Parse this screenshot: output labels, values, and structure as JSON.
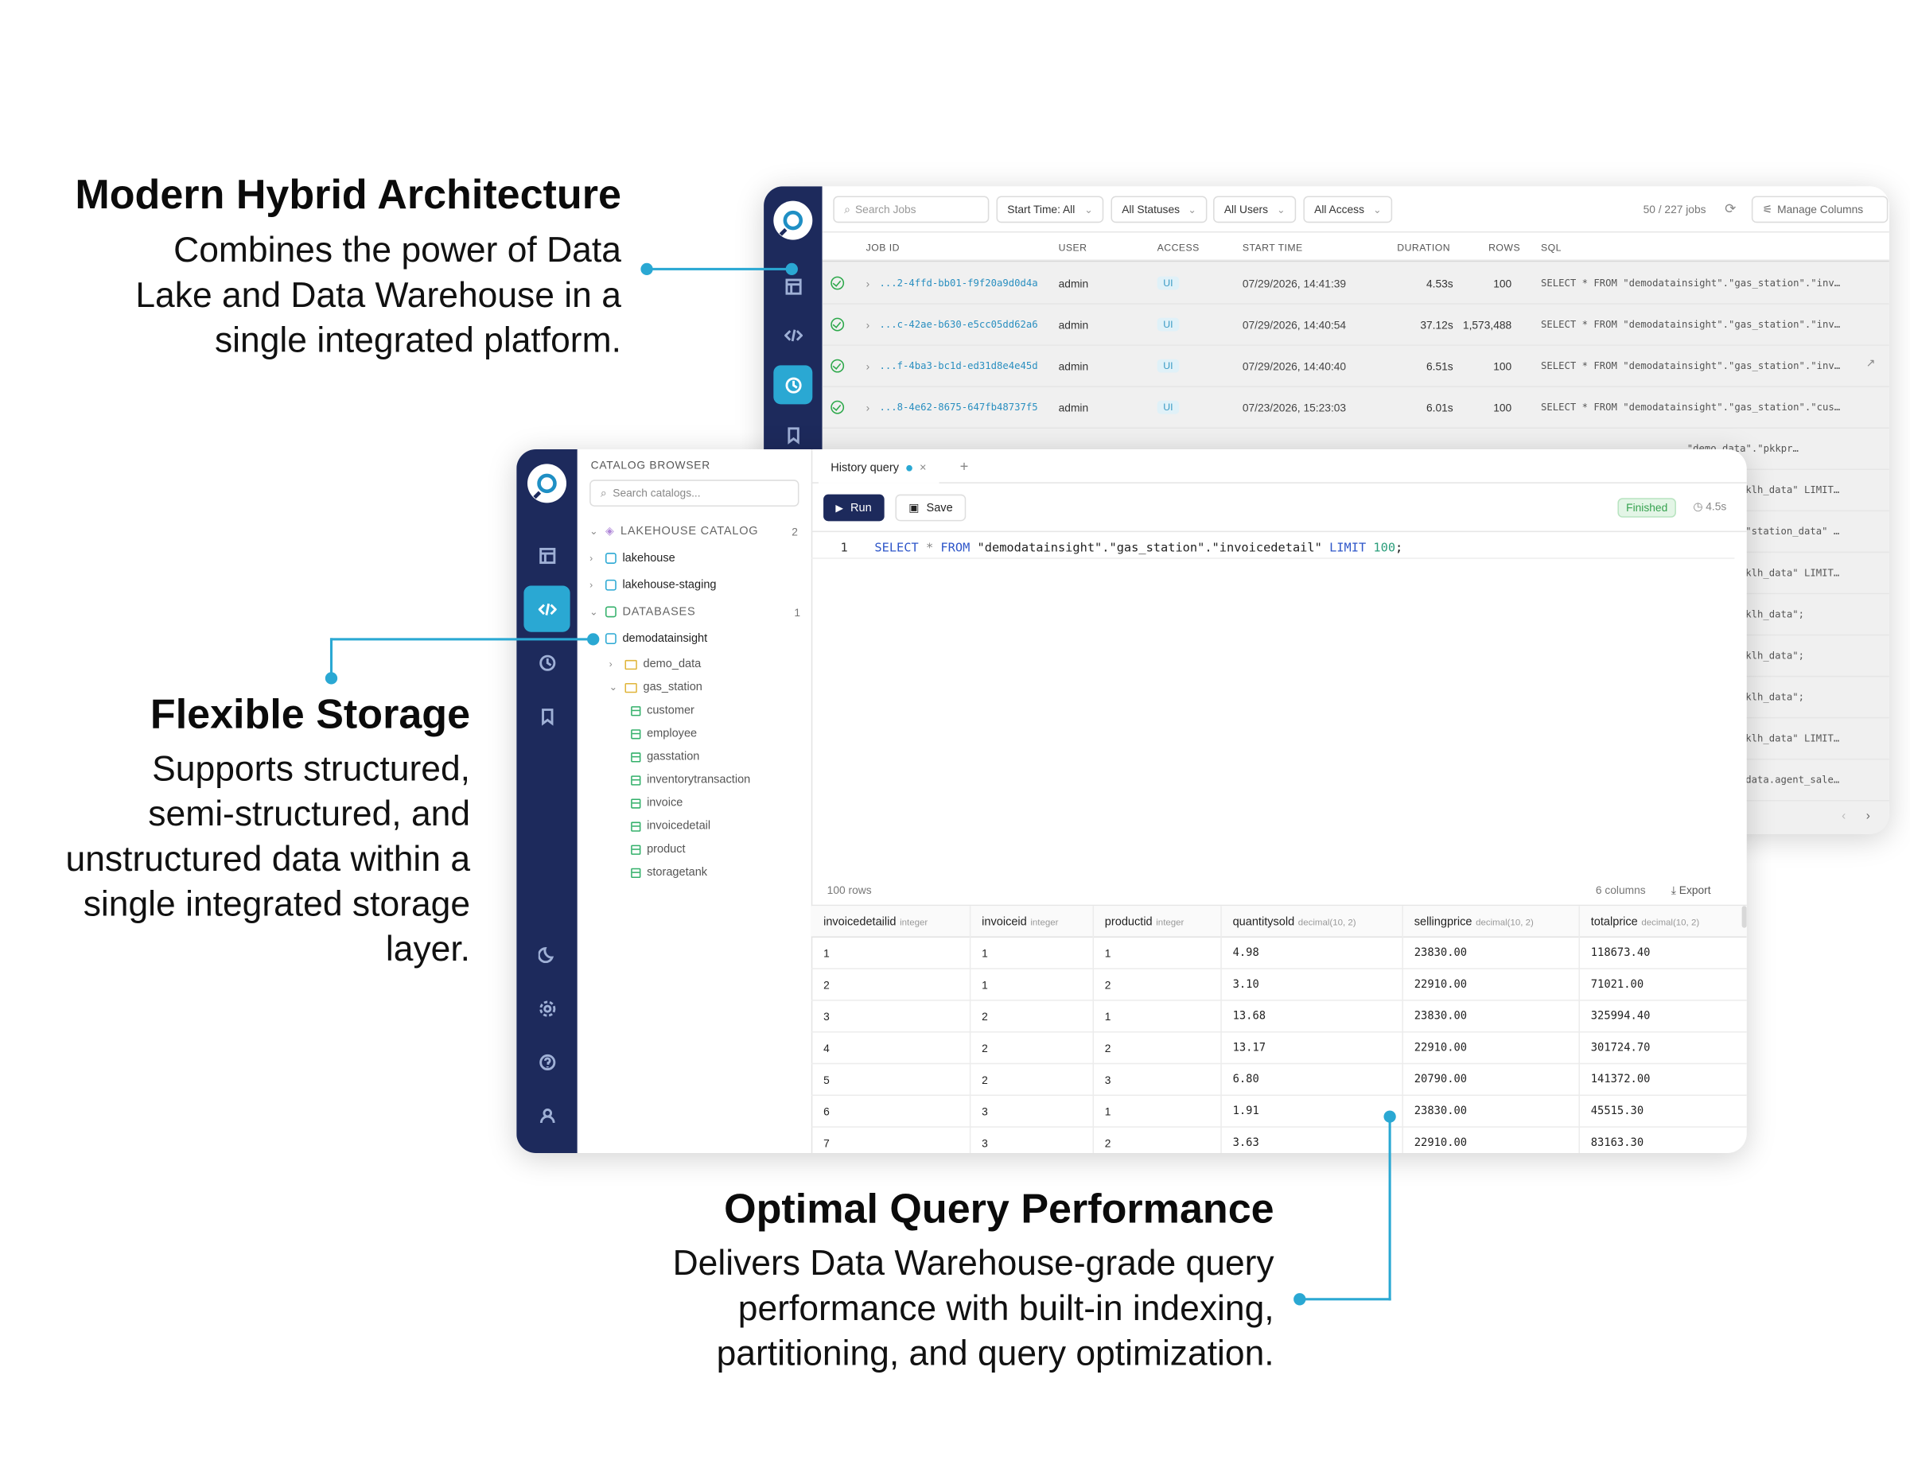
{
  "callouts": {
    "architecture": {
      "title": "Modern Hybrid Architecture",
      "lines": [
        "Combines the power of Data",
        "Lake and Data Warehouse in a",
        "single integrated platform."
      ]
    },
    "storage": {
      "title": "Flexible Storage",
      "lines": [
        "Supports structured,",
        "semi-structured, and",
        "unstructured data within a",
        "single integrated storage",
        "layer."
      ]
    },
    "performance": {
      "title": "Optimal Query Performance",
      "lines": [
        "Delivers Data Warehouse-grade query",
        "performance with built-in indexing,",
        "partitioning, and query optimization."
      ]
    }
  },
  "jobs": {
    "search_placeholder": "Search Jobs",
    "filters": [
      "Start Time: All",
      "All Statuses",
      "All Users",
      "All Access"
    ],
    "count": "50 / 227 jobs",
    "manage_columns": "Manage Columns",
    "columns": [
      "JOB ID",
      "USER",
      "ACCESS",
      "START TIME",
      "DURATION",
      "ROWS",
      "SQL"
    ],
    "rows": [
      {
        "id": "...2-4ffd-bb01-f9f20a9d0d4a",
        "user": "admin",
        "access": "UI",
        "start": "07/29/2026, 14:41:39",
        "duration": "4.53s",
        "rows": "100",
        "sql": "SELECT * FROM \"demodatainsight\".\"gas_station\".\"inv…"
      },
      {
        "id": "...c-42ae-b630-e5cc05dd62a6",
        "user": "admin",
        "access": "UI",
        "start": "07/29/2026, 14:40:54",
        "duration": "37.12s",
        "rows": "1,573,488",
        "sql": "SELECT * FROM \"demodatainsight\".\"gas_station\".\"inv…"
      },
      {
        "id": "...f-4ba3-bc1d-ed31d8e4e45d",
        "user": "admin",
        "access": "UI",
        "start": "07/29/2026, 14:40:40",
        "duration": "6.51s",
        "rows": "100",
        "sql": "SELECT * FROM \"demodatainsight\".\"gas_station\".\"inv…"
      },
      {
        "id": "...8-4e62-8675-647fb48737f5",
        "user": "admin",
        "access": "UI",
        "start": "07/23/2026, 15:23:03",
        "duration": "6.01s",
        "rows": "100",
        "sql": "SELECT * FROM \"demodatainsight\".\"gas_station\".\"cus…"
      }
    ],
    "partial_sql": [
      "\"demo_data\".\"pkkpr…",
      "klh_data\" LIMIT…",
      "\"station_data\" …",
      "klh_data\" LIMIT…",
      "klh_data\";",
      "klh_data\";",
      "klh_data\";",
      "klh_data\" LIMIT…",
      "data.agent_sale…"
    ]
  },
  "catalog": {
    "title": "CATALOG BROWSER",
    "search_placeholder": "Search catalogs...",
    "lakehouse_section": "LAKEHOUSE CATALOG",
    "lakehouse_count": "2",
    "lakehouse_items": [
      "lakehouse",
      "lakehouse-staging"
    ],
    "databases_section": "DATABASES",
    "databases_count": "1",
    "database": "demodatainsight",
    "schemas": [
      "demo_data",
      "gas_station"
    ],
    "tables": [
      "customer",
      "employee",
      "gasstation",
      "inventorytransaction",
      "invoice",
      "invoicedetail",
      "product",
      "storagetank"
    ]
  },
  "editor": {
    "tab_label": "History query",
    "add_tab": "+",
    "run_label": "Run",
    "save_label": "Save",
    "status": "Finished",
    "elapsed": "4.5s",
    "line_number": "1",
    "sql_kw1": "SELECT",
    "sql_star": "*",
    "sql_kw2": "FROM",
    "sql_ident": "\"demodatainsight\".\"gas_station\".\"invoicedetail\"",
    "sql_kw3": "LIMIT",
    "sql_num": "100",
    "sql_end": ";"
  },
  "results": {
    "row_count": "100 rows",
    "col_count": "6 columns",
    "export_label": "Export",
    "columns": [
      {
        "name": "invoicedetailid",
        "type": "integer"
      },
      {
        "name": "invoiceid",
        "type": "integer"
      },
      {
        "name": "productid",
        "type": "integer"
      },
      {
        "name": "quantitysold",
        "type": "decimal(10, 2)"
      },
      {
        "name": "sellingprice",
        "type": "decimal(10, 2)"
      },
      {
        "name": "totalprice",
        "type": "decimal(10, 2)"
      }
    ],
    "rows": [
      [
        "1",
        "1",
        "1",
        "4.98",
        "23830.00",
        "118673.40"
      ],
      [
        "2",
        "1",
        "2",
        "3.10",
        "22910.00",
        "71021.00"
      ],
      [
        "3",
        "2",
        "1",
        "13.68",
        "23830.00",
        "325994.40"
      ],
      [
        "4",
        "2",
        "2",
        "13.17",
        "22910.00",
        "301724.70"
      ],
      [
        "5",
        "2",
        "3",
        "6.80",
        "20790.00",
        "141372.00"
      ],
      [
        "6",
        "3",
        "1",
        "1.91",
        "23830.00",
        "45515.30"
      ],
      [
        "7",
        "3",
        "2",
        "3.63",
        "22910.00",
        "83163.30"
      ]
    ]
  },
  "colors": {
    "accent": "#2aa8d3",
    "sidebar": "#1d2a5c",
    "success": "#36a24f"
  }
}
